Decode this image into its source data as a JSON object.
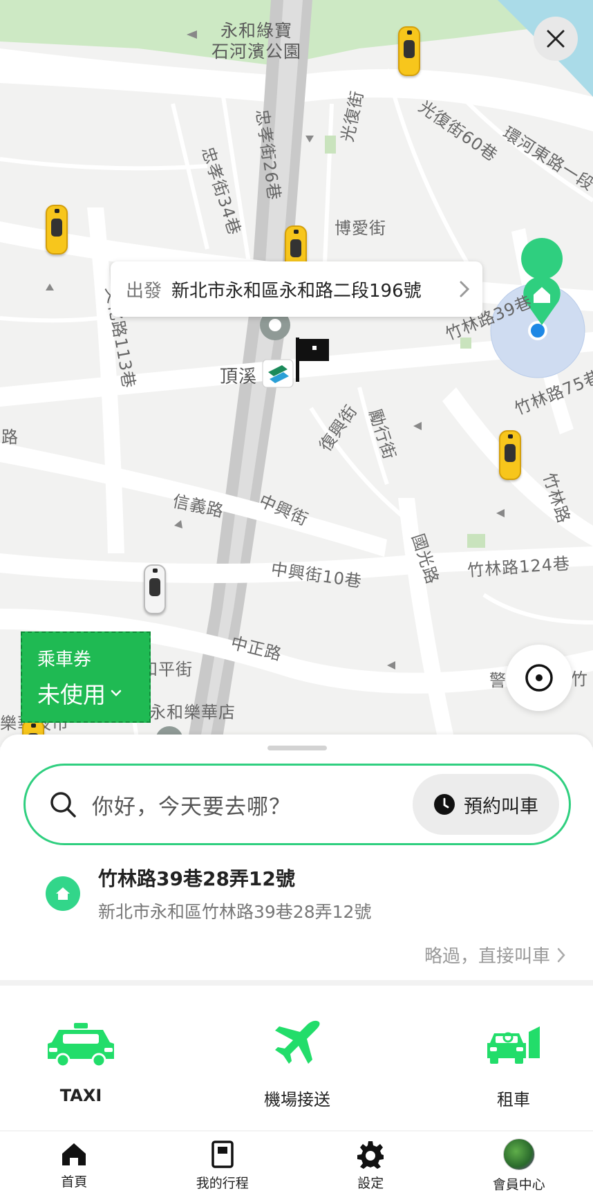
{
  "map": {
    "labels": {
      "park": "永和綠寶\n石河濱公園",
      "guangfu_st": "光復街",
      "guangfu_60": "光復街60巷",
      "huanhe_east": "環河東路一段",
      "zhongxiao_26": "忠孝街26巷",
      "zhongxiao_34": "忠孝街34巷",
      "boai": "博愛街",
      "wenhua_113": "文化路113巷",
      "zhulin_39": "竹林路39巷",
      "zhulin_75": "竹林路75巷",
      "dingxi": "頂溪",
      "fuxing": "復興街",
      "dongxing": "勵行街",
      "lu_left": "路",
      "zhulin": "竹林路",
      "xinyi": "信義路",
      "zhongxing": "中興街",
      "zhongxing_10": "中興街10巷",
      "guoguang": "國光路",
      "zhulin_124": "竹林路124巷",
      "zhongzheng": "中正路",
      "heping": "和平街",
      "ktv": "錢櫃KTV永和樂華店",
      "lehua": "樂華夜市",
      "jing": "警",
      "zhu_right": "竹"
    }
  },
  "pickup": {
    "label": "出發",
    "address": "新北市永和區永和路二段196號"
  },
  "coupon": {
    "title": "乘車券",
    "status": "未使用"
  },
  "search": {
    "placeholder": "你好，今天要去哪？",
    "reserve_label": "預約叫車"
  },
  "recent": {
    "name": "竹林路39巷28弄12號",
    "address": "新北市永和區竹林路39巷28弄12號"
  },
  "skip_label": "略過，直接叫車",
  "services": [
    {
      "label": "TAXI",
      "icon": "taxi-icon"
    },
    {
      "label": "機場接送",
      "icon": "airplane-icon"
    },
    {
      "label": "租車",
      "icon": "rental-car-icon"
    }
  ],
  "tabs": [
    {
      "label": "首頁",
      "icon": "home-icon"
    },
    {
      "label": "我的行程",
      "icon": "trips-icon"
    },
    {
      "label": "設定",
      "icon": "gear-icon"
    },
    {
      "label": "會員中心",
      "icon": "avatar"
    }
  ],
  "colors": {
    "accent": "#2fcf7f",
    "coupon": "#1fba53",
    "taxi": "#f7c61c",
    "service_icon": "#22dd6a"
  }
}
